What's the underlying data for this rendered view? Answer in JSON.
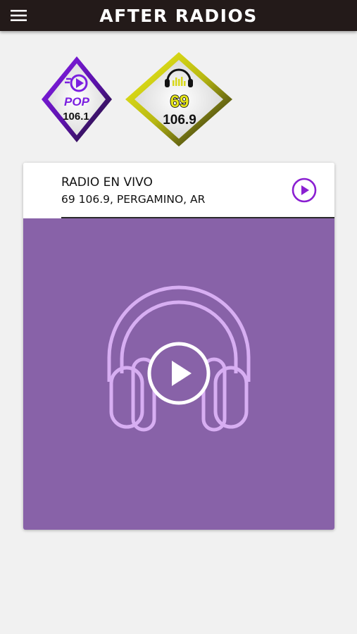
{
  "header": {
    "title": "AFTER RADIOS",
    "menu_icon": "hamburger-menu-icon"
  },
  "stations": [
    {
      "logo_text_top": "POP",
      "logo_text_bottom": "106.1",
      "accent": "#7b1fe0"
    },
    {
      "logo_text_top": "69",
      "logo_text_bottom": "106.9",
      "accent": "#e6e619"
    }
  ],
  "player_card": {
    "title": "RADIO EN VIVO",
    "subtitle": "69 106.9, PERGAMINO, AR",
    "play_icon": "play-circle-icon",
    "media_icon": "headphones-icon",
    "media_bg": "#8862a8",
    "accent": "#8a1fd1"
  },
  "colors": {
    "appbar_bg": "#231a19",
    "page_bg": "#f1f1f1"
  }
}
